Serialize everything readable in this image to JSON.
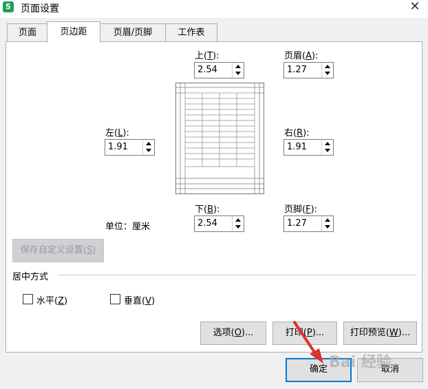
{
  "window": {
    "title": "页面设置",
    "app_icon": "S"
  },
  "tabs": [
    {
      "label": "页面",
      "active": false
    },
    {
      "label": "页边距",
      "active": true
    },
    {
      "label": "页眉/页脚",
      "active": false
    },
    {
      "label": "工作表",
      "active": false
    }
  ],
  "margins": {
    "top": {
      "label": "上",
      "key": "T",
      "value": "2.54"
    },
    "header": {
      "label": "页眉",
      "key": "A",
      "value": "1.27"
    },
    "left": {
      "label": "左",
      "key": "L",
      "value": "1.91"
    },
    "right": {
      "label": "右",
      "key": "R",
      "value": "1.91"
    },
    "bottom": {
      "label": "下",
      "key": "B",
      "value": "2.54"
    },
    "footer": {
      "label": "页脚",
      "key": "F",
      "value": "1.27"
    }
  },
  "unit_label": "单位：厘米",
  "save_custom": {
    "label": "保存自定义设置",
    "key": "S"
  },
  "center": {
    "section_title": "居中方式",
    "horizontal": {
      "label": "水平",
      "key": "Z",
      "checked": false
    },
    "vertical": {
      "label": "垂直",
      "key": "V",
      "checked": false
    }
  },
  "buttons": {
    "options": {
      "label": "选项",
      "key": "O",
      "suffix": "..."
    },
    "print": {
      "label": "打印",
      "key": "P",
      "suffix": "..."
    },
    "print_preview": {
      "label": "打印预览",
      "key": "W",
      "suffix": "..."
    },
    "ok": {
      "label": "确定"
    },
    "cancel": {
      "label": "取消"
    }
  },
  "watermark": "Bai 经验",
  "colors": {
    "accent": "#0078d7",
    "arrow": "#e03030"
  }
}
